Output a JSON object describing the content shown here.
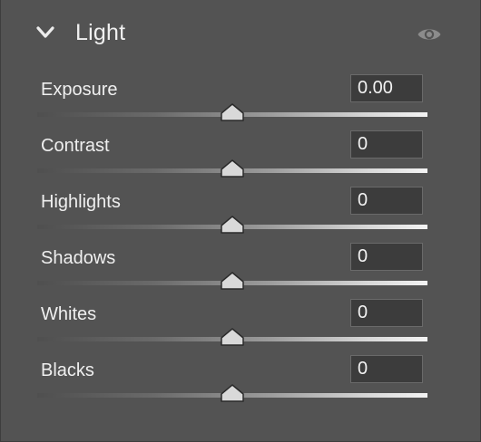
{
  "panel": {
    "title": "Light",
    "collapse_icon": "chevron-down-icon",
    "visibility_icon": "eye-icon"
  },
  "sliders": [
    {
      "label": "Exposure",
      "value": "0.00",
      "position": 0.5
    },
    {
      "label": "Contrast",
      "value": "0",
      "position": 0.5
    },
    {
      "label": "Highlights",
      "value": "0",
      "position": 0.5
    },
    {
      "label": "Shadows",
      "value": "0",
      "position": 0.5
    },
    {
      "label": "Whites",
      "value": "0",
      "position": 0.5
    },
    {
      "label": "Blacks",
      "value": "0",
      "position": 0.5
    }
  ],
  "colors": {
    "panel_background": "#535353",
    "field_background": "#3c3c3c",
    "text": "#efefef",
    "thumb": "#d9d9d9"
  }
}
